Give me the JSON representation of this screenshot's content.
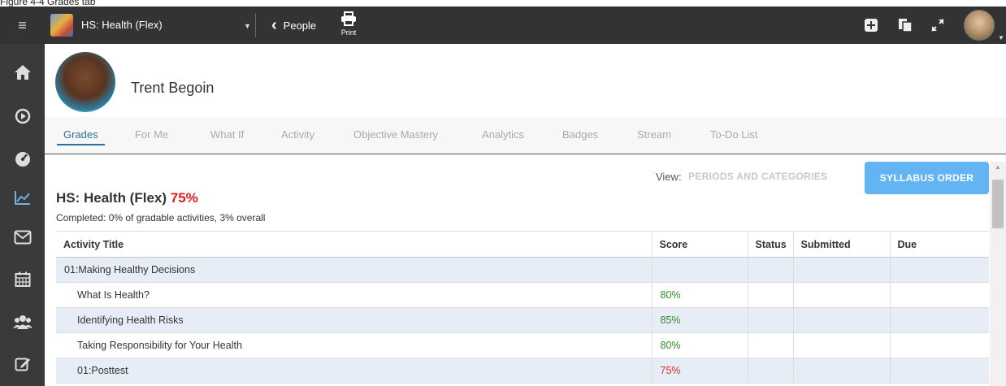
{
  "caption": "Figure 4-4 Grades tab",
  "topbar": {
    "course_name": "HS: Health (Flex)",
    "back_label": "People",
    "print_label": "Print"
  },
  "sidebar": {
    "items": [
      "home-icon",
      "play-circle-icon",
      "dashboard-icon",
      "line-chart-icon",
      "envelope-icon",
      "calendar-icon",
      "users-icon",
      "edit-icon"
    ]
  },
  "student": {
    "name": "Trent Begoin"
  },
  "tabs": [
    {
      "label": "Grades",
      "active": true
    },
    {
      "label": "For Me"
    },
    {
      "label": "What If"
    },
    {
      "label": "Activity"
    },
    {
      "label": "Objective Mastery"
    },
    {
      "label": "Analytics"
    },
    {
      "label": "Badges"
    },
    {
      "label": "Stream"
    },
    {
      "label": "To-Do List"
    }
  ],
  "view": {
    "label": "View:",
    "periods": "PERIODS AND CATEGORIES",
    "syllabus": "SYLLABUS ORDER"
  },
  "course": {
    "title": "HS: Health (Flex)",
    "percent": "75%",
    "completed": "Completed: 0% of gradable activities, 3% overall"
  },
  "table": {
    "columns": [
      "Activity Title",
      "Score",
      "Status",
      "Submitted",
      "Due"
    ],
    "rows": [
      {
        "title": "01:Making Healthy Decisions",
        "score": "",
        "status": "",
        "submitted": "",
        "due": ""
      },
      {
        "title": "What Is Health?",
        "score": "80%",
        "status": "",
        "submitted": "",
        "due": ""
      },
      {
        "title": "Identifying Health Risks",
        "score": "85%",
        "status": "",
        "submitted": "",
        "due": ""
      },
      {
        "title": "Taking Responsibility for Your Health",
        "score": "80%",
        "status": "",
        "submitted": "",
        "due": ""
      },
      {
        "title": "01:Posttest",
        "score": "75%",
        "status": "",
        "submitted": "",
        "due": ""
      }
    ]
  },
  "colors": {
    "topbar": "#333333",
    "sidebar": "#3a3a3a",
    "accent": "#62b4f2",
    "tab_active": "#2f6e9c",
    "score_pass": "#2e8b2e",
    "score_fail": "#d83030"
  }
}
